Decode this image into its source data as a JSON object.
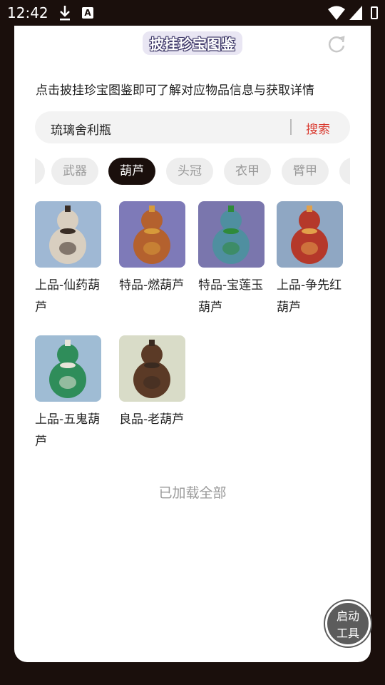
{
  "status": {
    "time": "12:42"
  },
  "header": {
    "title": "披挂珍宝图鉴"
  },
  "description": "点击披挂珍宝图鉴即可了解对应物品信息与获取详情",
  "search": {
    "value": "琉璃舍利瓶",
    "button": "搜索"
  },
  "tabs": [
    "武器",
    "葫芦",
    "头冠",
    "衣甲",
    "臂甲"
  ],
  "active_tab": "葫芦",
  "items": [
    {
      "name": "上品-仙药葫芦",
      "bg": "#9fb8d4",
      "gourd": "#d9cfc0",
      "accent": "#3a2e26"
    },
    {
      "name": "特品-燃葫芦",
      "bg": "#7e7ab8",
      "gourd": "#b4612e",
      "accent": "#d79a3a"
    },
    {
      "name": "特品-宝莲玉葫芦",
      "bg": "#7a76ad",
      "gourd": "#4f8fa0",
      "accent": "#2f8a3a"
    },
    {
      "name": "上品-争先红葫芦",
      "bg": "#8fa7c3",
      "gourd": "#b5382a",
      "accent": "#e2a04a"
    },
    {
      "name": "上品-五鬼葫芦",
      "bg": "#9fbcd4",
      "gourd": "#2f8d5a",
      "accent": "#e8e4d8"
    },
    {
      "name": "良品-老葫芦",
      "bg": "#d9dcc8",
      "gourd": "#5b3a26",
      "accent": "#3a2a20"
    }
  ],
  "footer": {
    "loaded": "已加载全部"
  },
  "fab": {
    "line1": "启动",
    "line2": "工具"
  }
}
